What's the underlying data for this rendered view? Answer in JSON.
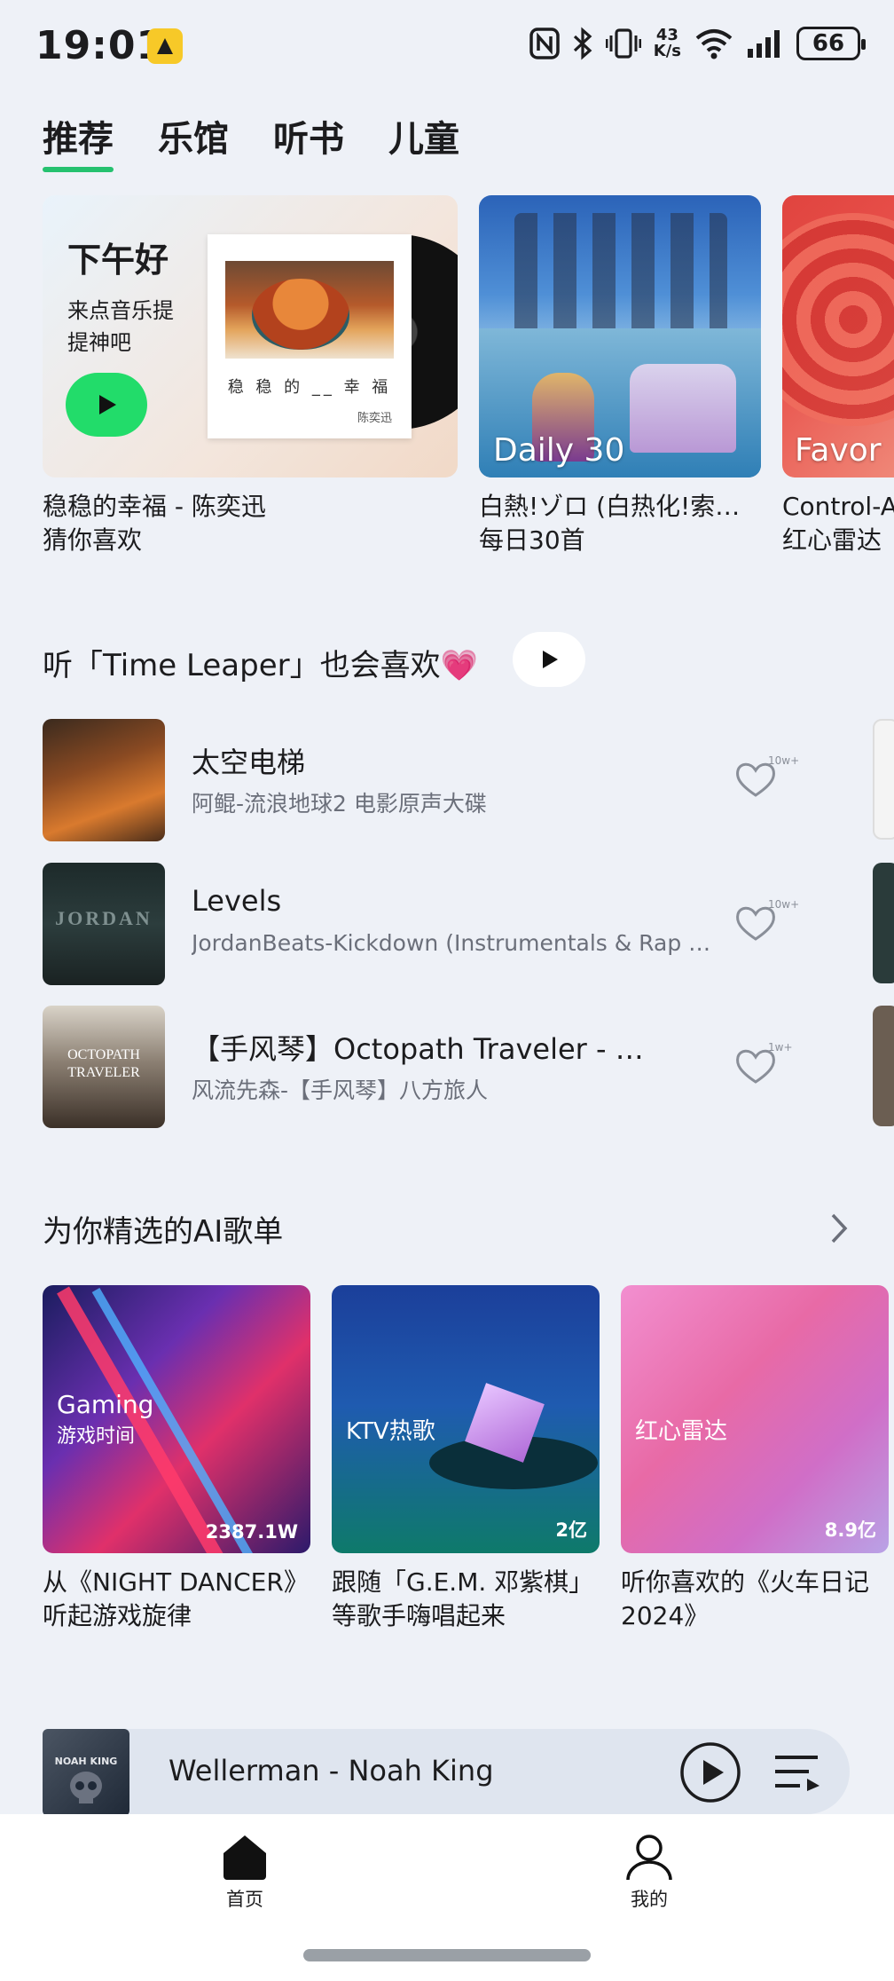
{
  "status": {
    "time": "19:01",
    "netspeed_value": "43",
    "netspeed_unit": "K/s",
    "battery": "66"
  },
  "tabs": [
    {
      "label": "推荐",
      "active": true
    },
    {
      "label": "乐馆",
      "active": false
    },
    {
      "label": "听书",
      "active": false
    },
    {
      "label": "儿童",
      "active": false
    }
  ],
  "featured": [
    {
      "greeting": "下午好",
      "subtitle": "来点音乐提提神吧",
      "cover_title": "稳 稳 的 __ 幸 福",
      "cover_artist": "陈奕迅",
      "caption_line1": "稳稳的幸福 - 陈奕迅",
      "caption_line2": "猜你喜欢"
    },
    {
      "overlay": "Daily 30",
      "caption_line1": "白熱!ゾロ (白热化!索…",
      "caption_line2": "每日30首"
    },
    {
      "overlay": "Favor",
      "caption_line1": "Control-A",
      "caption_line2": "红心雷达"
    }
  ],
  "similar": {
    "title": "听「Time Leaper」也会喜欢💗",
    "songs": [
      {
        "title": "太空电梯",
        "subtitle": "阿鲲-流浪地球2 电影原声大碟",
        "likes": "10w+"
      },
      {
        "title": "Levels",
        "subtitle": "JordanBeats-Kickdown (Instrumentals & Rap …",
        "likes": "10w+"
      },
      {
        "title": "【手风琴】Octopath Traveler - …",
        "subtitle": "风流先森-【手风琴】八方旅人",
        "likes": "1w+"
      }
    ]
  },
  "ai_playlists": {
    "title": "为你精选的AI歌单",
    "items": [
      {
        "label_en": "Gaming",
        "label_cn": "游戏时间",
        "count": "2387.1W",
        "caption": "从《NIGHT DANCER》听起游戏旋律"
      },
      {
        "label_cn": "KTV热歌",
        "count": "2亿",
        "caption": "跟随「G.E.M. 邓紫棋」等歌手嗨唱起来"
      },
      {
        "label_cn": "红心雷达",
        "count": "8.9亿",
        "caption": "听你喜欢的《火车日记2024》"
      }
    ]
  },
  "now_playing": {
    "title": "Wellerman - Noah King",
    "art_text": "NOAH KING"
  },
  "bottom_nav": [
    {
      "label": "首页",
      "icon": "home-icon",
      "active": true
    },
    {
      "label": "我的",
      "icon": "profile-icon",
      "active": false
    }
  ],
  "colors": {
    "accent": "#25c16f",
    "play_green": "#22dc6a",
    "background": "#eef1f7"
  }
}
